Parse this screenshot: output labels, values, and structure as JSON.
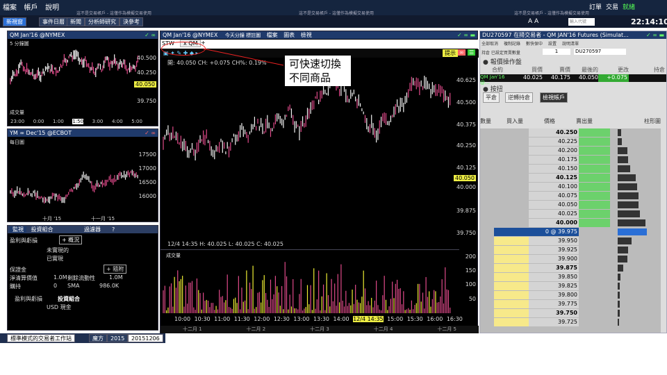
{
  "menubar": {
    "items": [
      "檔案",
      "帳戶",
      "說明"
    ],
    "right": [
      "訂單",
      "交易",
      "就緒"
    ],
    "notice": "這不是交易帳戶 - 這僅作為模擬交易使用"
  },
  "toolbar": {
    "buttons": [
      "新視窗",
      "事件日曆",
      "新聞",
      "分析師研究",
      "決參考"
    ],
    "right_aa": "A A",
    "right_search": "輸入代號",
    "clock": "22:14:10"
  },
  "chart1": {
    "title": "QM Jan'16 @NYMEX",
    "interval": "5 分鐘圖",
    "yticks": [
      "40.500",
      "40.250",
      "40.050",
      "39.750"
    ],
    "highlight": "40.050",
    "xticks": [
      "23:00",
      "0:00",
      "1:00",
      "1:50",
      "3:00",
      "4:00",
      "5:00"
    ],
    "sub_label": "成交量"
  },
  "chart2": {
    "title": "YM ∞ Dec'15 @ECBOT",
    "interval": "每日圖",
    "yticks": [
      "17500",
      "17000",
      "16500",
      "16000"
    ],
    "xticks": [
      "十月 '15",
      "十一月 '15"
    ]
  },
  "acct": {
    "tabs": [
      "監視",
      "投資組合"
    ],
    "filter": "過濾器",
    "help": "?",
    "pnl_label": "盈利與虧損",
    "overview_btn": "概況",
    "unrealized": "未實現的",
    "realized": "已實現",
    "margin_label": "保證金",
    "margin_btn": "隨附",
    "netliq_label": "淨清算價值",
    "netliq_val": "1.0M",
    "excess_label": "剩餘流動性",
    "excess_val": "1.0M",
    "hold_label": "購持",
    "hold_val": "0",
    "sma_label": "SMA",
    "sma_val": "986.0K",
    "pnl2_label": "盈利與虧損",
    "portfolio": "投資組合",
    "cash": "USD 現金"
  },
  "main": {
    "title": "QM Jan'16 @NYMEX",
    "tab": "STW",
    "tab2": "x QM",
    "add_tab": "+",
    "menu": [
      "今天分鐘 標註圖",
      "檔案",
      "圖表",
      "檢視"
    ],
    "hint": "提示",
    "ohlc_top": "開: 40.050 CH: +0.075 CH%: 0.19%",
    "ohlc_bottom": "12/4 14:35  H: 40.025  L: 40.025  C: 40.025",
    "yticks": [
      "40.625",
      "40.500",
      "40.375",
      "40.250",
      "40.125",
      "40.050",
      "40.000",
      "39.875",
      "39.750"
    ],
    "highlight": "40.050",
    "vol_label": "成交量",
    "vol_ticks": [
      "200",
      "150",
      "100",
      "50"
    ],
    "xticks": [
      "10:00",
      "10:30",
      "11:00",
      "11:30",
      "12:00",
      "12:30",
      "13:00",
      "13:30",
      "14:00",
      "12/4 14:35",
      "15:00",
      "15:30",
      "16:00",
      "16:30"
    ],
    "hl_x": "12/4 14:35",
    "bottom_months": [
      "十二月 1",
      "十二月 2",
      "十二月 3",
      "十二月 4",
      "十二月 5"
    ]
  },
  "annotation": {
    "line1": "可快速切換",
    "line2": "不同商品"
  },
  "dom": {
    "title": "DU270597 在掃交易者 - QM JAN'16 Futures (Simulat...",
    "toolbar": [
      "全部取消",
      "複制記錄",
      "數快保中",
      "設置",
      "說明清單"
    ],
    "default_qty_label": "持倉 已設定買賣數量",
    "qty": "1",
    "account": "DU270597",
    "section1": "報價操作盤",
    "cols": [
      "合約",
      "買價",
      "賣價",
      "最後的",
      "更改",
      "持倉"
    ],
    "contract": "QM Jan'16 @...",
    "bid": "40.025",
    "ask": "40.175",
    "last": "40.050",
    "change": "+0.075",
    "section2": "按扭",
    "btns": [
      "平倉",
      "逆轉持倉",
      "檢視帳戶"
    ],
    "hdr": [
      "數量",
      "買入量",
      "價格",
      "賣出量",
      "柱形圖"
    ],
    "prices": [
      "40.250",
      "40.225",
      "40.200",
      "40.175",
      "40.150",
      "40.125",
      "40.100",
      "40.075",
      "40.050",
      "40.025",
      "40.000",
      "0 @ 39.975",
      "39.950",
      "39.925",
      "39.900",
      "39.875",
      "39.850",
      "39.825",
      "39.800",
      "39.775",
      "39.750",
      "39.725"
    ],
    "bold": [
      "40.250",
      "40.125",
      "40.000",
      "39.875",
      "39.750"
    ],
    "zero": "0"
  },
  "taskbar": {
    "tabs": [
      "標準模式的交易者工作站",
      "魔方",
      "2015",
      "20151206"
    ]
  }
}
